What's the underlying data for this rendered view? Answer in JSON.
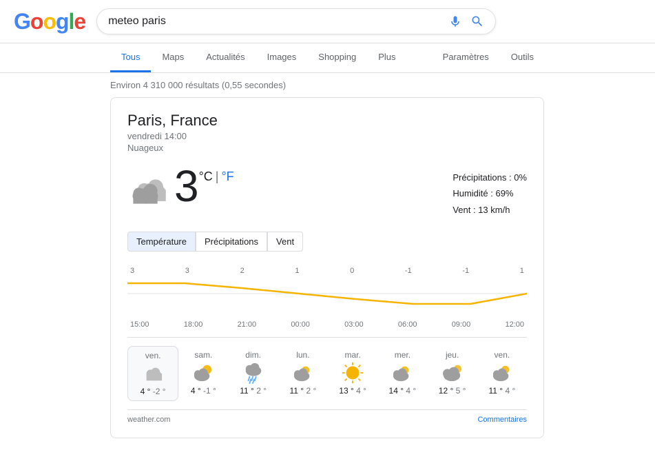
{
  "header": {
    "logo": "Google",
    "search_value": "meteo paris"
  },
  "nav": {
    "tabs": [
      {
        "label": "Tous",
        "active": true
      },
      {
        "label": "Maps",
        "active": false
      },
      {
        "label": "Actualités",
        "active": false
      },
      {
        "label": "Images",
        "active": false
      },
      {
        "label": "Shopping",
        "active": false
      },
      {
        "label": "Plus",
        "active": false
      }
    ],
    "right_tabs": [
      {
        "label": "Paramètres"
      },
      {
        "label": "Outils"
      }
    ]
  },
  "results": {
    "count_text": "Environ 4 310 000 résultats (0,55 secondes)"
  },
  "weather": {
    "location": "Paris, France",
    "time": "vendredi 14:00",
    "condition": "Nuageux",
    "temperature": "3",
    "unit_celsius": "°C",
    "unit_separator": "|",
    "unit_fahrenheit": "°F",
    "precipitation": "Précipitations : 0%",
    "humidity": "Humidité : 69%",
    "wind": "Vent : 13 km/h",
    "chart_tabs": [
      {
        "label": "Température",
        "active": true
      },
      {
        "label": "Précipitations",
        "active": false
      },
      {
        "label": "Vent",
        "active": false
      }
    ],
    "temp_values": [
      "3",
      "3",
      "2",
      "1",
      "0",
      "-1",
      "-1",
      "1"
    ],
    "time_values": [
      "15:00",
      "18:00",
      "21:00",
      "00:00",
      "03:00",
      "06:00",
      "09:00",
      "12:00"
    ],
    "forecast": [
      {
        "day": "ven.",
        "hi": "4 °",
        "lo": "-2 °",
        "today": true,
        "icon": "cloudy"
      },
      {
        "day": "sam.",
        "hi": "4 °",
        "lo": "-1 °",
        "today": false,
        "icon": "partly_cloudy_day"
      },
      {
        "day": "dim.",
        "hi": "11 °",
        "lo": "2 °",
        "today": false,
        "icon": "rain"
      },
      {
        "day": "lun.",
        "hi": "11 °",
        "lo": "2 °",
        "today": false,
        "icon": "partly_cloudy"
      },
      {
        "day": "mar.",
        "hi": "13 °",
        "lo": "4 °",
        "today": false,
        "icon": "sunny"
      },
      {
        "day": "mer.",
        "hi": "14 °",
        "lo": "4 °",
        "today": false,
        "icon": "partly_cloudy"
      },
      {
        "day": "jeu.",
        "hi": "12 °",
        "lo": "5 °",
        "today": false,
        "icon": "cloudy_sun"
      },
      {
        "day": "ven.",
        "hi": "11 °",
        "lo": "4 °",
        "today": false,
        "icon": "partly_cloudy2"
      }
    ],
    "source": "weather.com",
    "feedback": "Commentaires"
  }
}
